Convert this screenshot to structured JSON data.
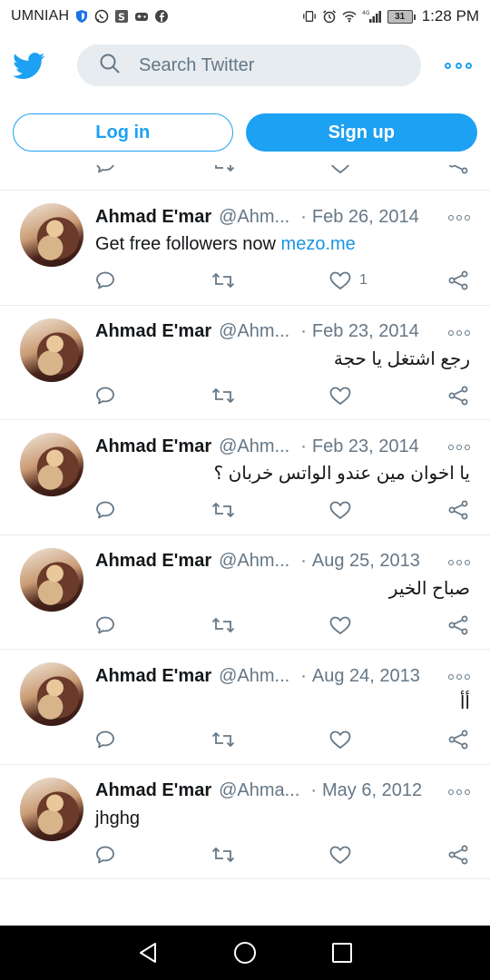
{
  "status_bar": {
    "carrier": "UMNIAH",
    "network": "4G",
    "battery": "31",
    "time": "1:28 PM"
  },
  "header": {
    "logo_icon": "twitter-bird-icon",
    "search_placeholder": "Search Twitter",
    "more_icon": "more-dots-icon"
  },
  "auth": {
    "login_label": "Log in",
    "signup_label": "Sign up"
  },
  "colors": {
    "accent": "#1da1f2",
    "link": "#1b95e0",
    "muted": "#657786"
  },
  "tweets": [
    {
      "name": "Ahmad E'mar",
      "handle": "@Ahm...",
      "date": "Feb 26, 2014",
      "text_prefix": "Get free followers now ",
      "link": "mezo.me",
      "likes": "1",
      "rtl": false
    },
    {
      "name": "Ahmad E'mar",
      "handle": "@Ahm...",
      "date": "Feb 23, 2014",
      "text": "رجع اشتغل يا حجة",
      "likes": "",
      "rtl": true
    },
    {
      "name": "Ahmad E'mar",
      "handle": "@Ahm...",
      "date": "Feb 23, 2014",
      "text": "يا اخوان مين عندو الواتس خربان ؟",
      "likes": "",
      "rtl": true
    },
    {
      "name": "Ahmad E'mar",
      "handle": "@Ahm...",
      "date": "Aug 25, 2013",
      "text": "صباح الخير",
      "likes": "",
      "rtl": true
    },
    {
      "name": "Ahmad E'mar",
      "handle": "@Ahm...",
      "date": "Aug 24, 2013",
      "text": "أأ",
      "likes": "",
      "rtl": true
    },
    {
      "name": "Ahmad E'mar",
      "handle": "@Ahma...",
      "date": "May 6, 2012",
      "text": "jhghg",
      "likes": "",
      "rtl": false
    }
  ]
}
